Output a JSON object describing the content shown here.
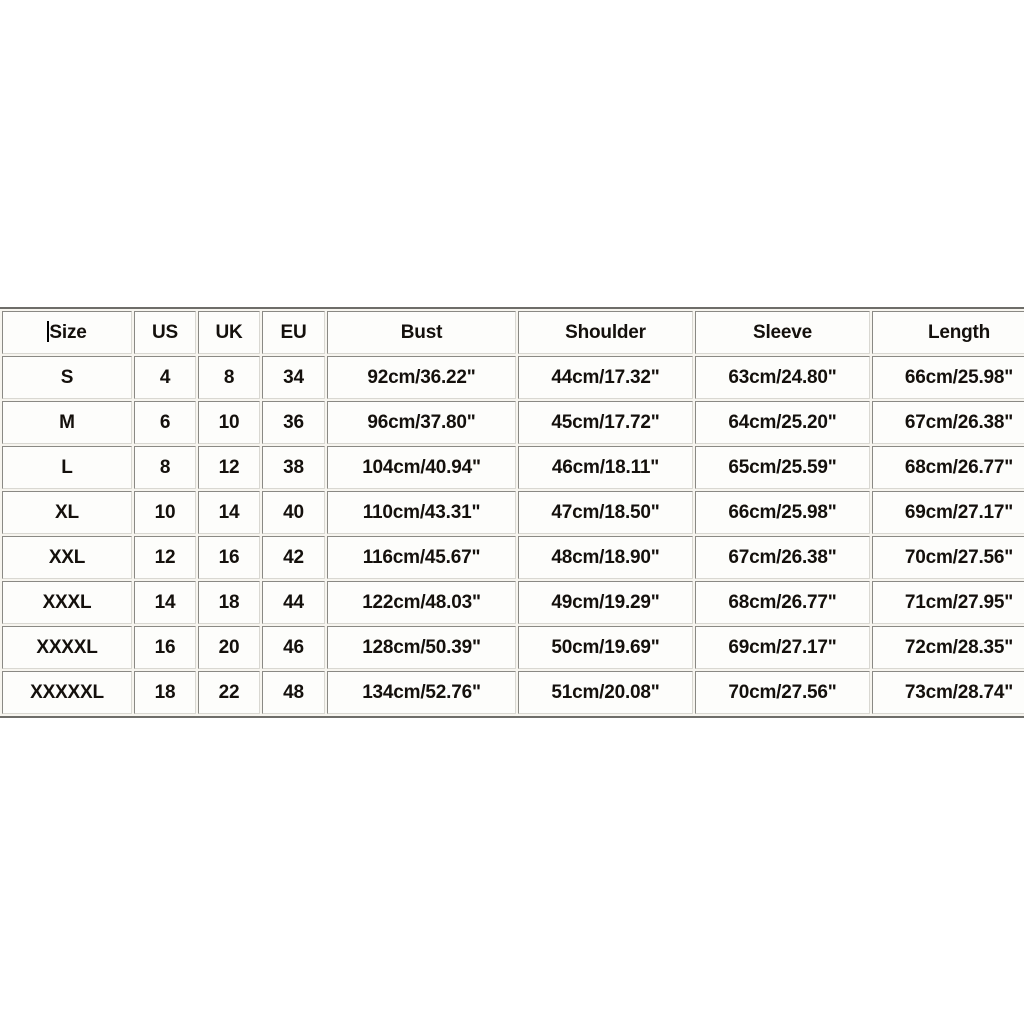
{
  "page": {
    "background_color": "#ffffff",
    "text_color": "#14100c",
    "cell_background": "#fdfdfb",
    "border_color": "#8a8984",
    "gutter_color": "#f7f5ef"
  },
  "table": {
    "name": "clothing-size-chart",
    "caret_visible": true,
    "columns": [
      "Size",
      "US",
      "UK",
      "EU",
      "Bust",
      "Shoulder",
      "Sleeve",
      "Length"
    ],
    "rows": [
      {
        "size": "S",
        "us": "4",
        "uk": "8",
        "eu": "34",
        "bust": "92cm/36.22\"",
        "shoulder": "44cm/17.32\"",
        "sleeve": "63cm/24.80\"",
        "length": "66cm/25.98\""
      },
      {
        "size": "M",
        "us": "6",
        "uk": "10",
        "eu": "36",
        "bust": "96cm/37.80\"",
        "shoulder": "45cm/17.72\"",
        "sleeve": "64cm/25.20\"",
        "length": "67cm/26.38\""
      },
      {
        "size": "L",
        "us": "8",
        "uk": "12",
        "eu": "38",
        "bust": "104cm/40.94\"",
        "shoulder": "46cm/18.11\"",
        "sleeve": "65cm/25.59\"",
        "length": "68cm/26.77\""
      },
      {
        "size": "XL",
        "us": "10",
        "uk": "14",
        "eu": "40",
        "bust": "110cm/43.31\"",
        "shoulder": "47cm/18.50\"",
        "sleeve": "66cm/25.98\"",
        "length": "69cm/27.17\""
      },
      {
        "size": "XXL",
        "us": "12",
        "uk": "16",
        "eu": "42",
        "bust": "116cm/45.67\"",
        "shoulder": "48cm/18.90\"",
        "sleeve": "67cm/26.38\"",
        "length": "70cm/27.56\""
      },
      {
        "size": "XXXL",
        "us": "14",
        "uk": "18",
        "eu": "44",
        "bust": "122cm/48.03\"",
        "shoulder": "49cm/19.29\"",
        "sleeve": "68cm/26.77\"",
        "length": "71cm/27.95\""
      },
      {
        "size": "XXXXL",
        "us": "16",
        "uk": "20",
        "eu": "46",
        "bust": "128cm/50.39\"",
        "shoulder": "50cm/19.69\"",
        "sleeve": "69cm/27.17\"",
        "length": "72cm/28.35\""
      },
      {
        "size": "XXXXXL",
        "us": "18",
        "uk": "22",
        "eu": "48",
        "bust": "134cm/52.76\"",
        "shoulder": "51cm/20.08\"",
        "sleeve": "70cm/27.56\"",
        "length": "73cm/28.74\""
      }
    ]
  }
}
